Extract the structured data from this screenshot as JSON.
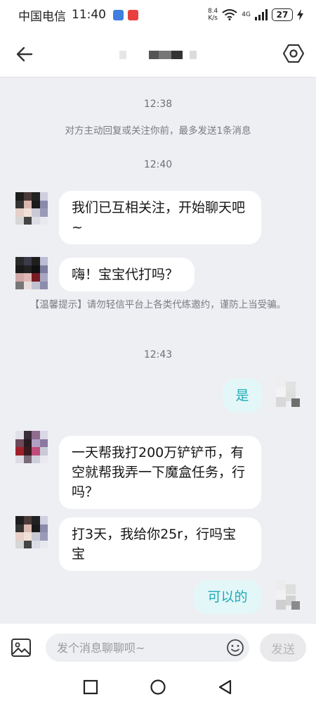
{
  "status_bar": {
    "carrier": "中国电信",
    "time": "11:40",
    "net_speed_value": "8.4",
    "net_speed_unit": "K/s",
    "signal_label": "4G",
    "battery": "27"
  },
  "header": {
    "icons": [
      "back-arrow-icon",
      "settings-hexagon-icon"
    ]
  },
  "chat": {
    "time_1": "12:38",
    "notice_1": "对方主动回复或关注你前，最多发送1条消息",
    "time_2": "12:40",
    "msg_1": "我们已互相关注，开始聊天吧~",
    "msg_2": "嗨！宝宝代打吗？",
    "notice_2": "【温馨提示】请勿轻信平台上各类代练邀约，谨防上当受骗。",
    "time_3": "12:43",
    "msg_3": "是",
    "msg_4": "一天帮我打200万铲铲币，有空就帮我弄一下魔盒任务，行吗？",
    "msg_5": "打3天，我给你25r，行吗宝宝",
    "msg_6": "可以的"
  },
  "input_bar": {
    "placeholder": "发个消息聊聊呗~",
    "send_label": "发送"
  },
  "colors": {
    "accent": "#1caab5",
    "my_bubble": "#e4f7f8",
    "background": "#eeeff3"
  }
}
